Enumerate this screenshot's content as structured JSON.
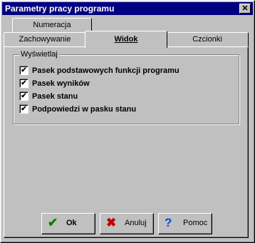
{
  "window": {
    "title": "Parametry pracy programu",
    "close_glyph": "✕"
  },
  "tabs": [
    {
      "label": "Numeracja",
      "active": false
    },
    {
      "label": "Zachowywanie",
      "active": false
    },
    {
      "label": "Widok",
      "active": true
    },
    {
      "label": "Czcionki",
      "active": false
    }
  ],
  "group": {
    "label": "Wyświetlaj"
  },
  "checkboxes": [
    {
      "label": "Pasek podstawowych funkcji programu",
      "checked": true
    },
    {
      "label": "Pasek wyników",
      "checked": true
    },
    {
      "label": "Pasek stanu",
      "checked": true
    },
    {
      "label": "Podpowiedzi w pasku stanu",
      "checked": true
    }
  ],
  "checkmark_glyph": "✔",
  "buttons": {
    "ok": {
      "label": "Ok",
      "icon": "checkmark-icon",
      "glyph": "✔",
      "color": "#008000"
    },
    "cancel": {
      "label": "Anuluj",
      "icon": "cross-icon",
      "glyph": "✖",
      "color": "#c00000"
    },
    "help": {
      "label": "Pomoc",
      "icon": "question-icon",
      "glyph": "?",
      "color": "#0050c0"
    }
  }
}
